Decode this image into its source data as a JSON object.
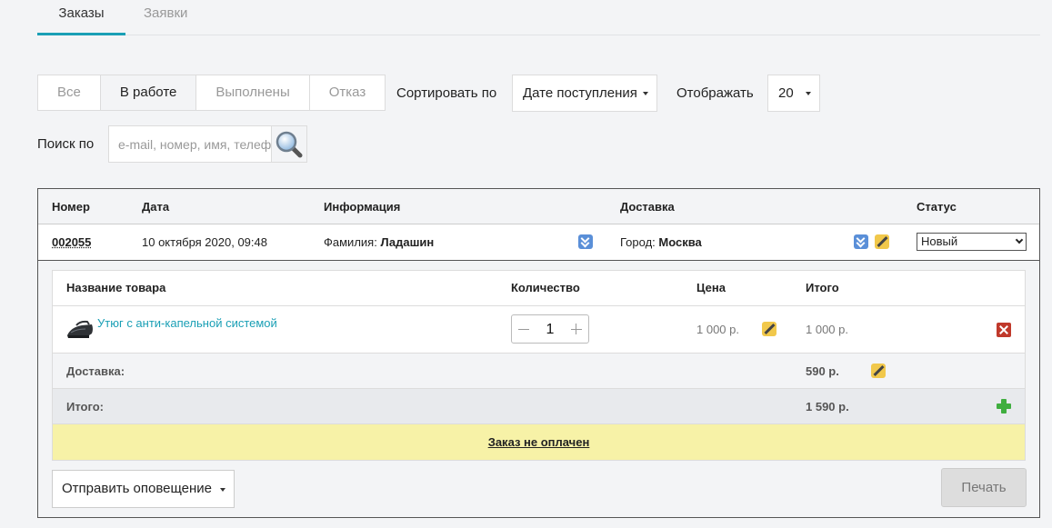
{
  "tabs": [
    {
      "label": "Заказы"
    },
    {
      "label": "Заявки"
    }
  ],
  "filters": {
    "buttons": [
      {
        "label": "Все"
      },
      {
        "label": "В работе"
      },
      {
        "label": "Выполнены"
      },
      {
        "label": "Отказ"
      }
    ],
    "sort_label": "Сортировать по",
    "sort_value": "Дате поступления",
    "display_label": "Отображать",
    "display_value": "20"
  },
  "search": {
    "label": "Поиск по",
    "placeholder": "e-mail, номер, имя, телефон"
  },
  "orders": {
    "headers": {
      "number": "Номер",
      "date": "Дата",
      "info": "Информация",
      "delivery": "Доставка",
      "status": "Статус"
    },
    "row": {
      "number": "002055",
      "date": "10 октября 2020, 09:48",
      "info_label": "Фамилия:",
      "info_value": "Ладашин",
      "delivery_label": "Город:",
      "delivery_value": "Москва",
      "status": "Новый"
    },
    "details": {
      "headers": {
        "product": "Название товара",
        "qty": "Количество",
        "price": "Цена",
        "total": "Итого"
      },
      "item": {
        "name": "Утюг с анти-капельной системой",
        "qty": "1",
        "price": "1 000 р.",
        "total": "1 000 р."
      },
      "delivery": {
        "label": "Доставка:",
        "value": "590 р."
      },
      "grand_total": {
        "label": "Итого:",
        "value": "1 590 р."
      },
      "unpaid": "Заказ не оплачен"
    },
    "notify_label": "Отправить оповещение",
    "print_label": "Печать"
  },
  "colors": {
    "accent": "#1a9fb5",
    "unpaid_bg": "#f7f2a7",
    "delete": "#c0392b",
    "add": "#3fae3f"
  }
}
